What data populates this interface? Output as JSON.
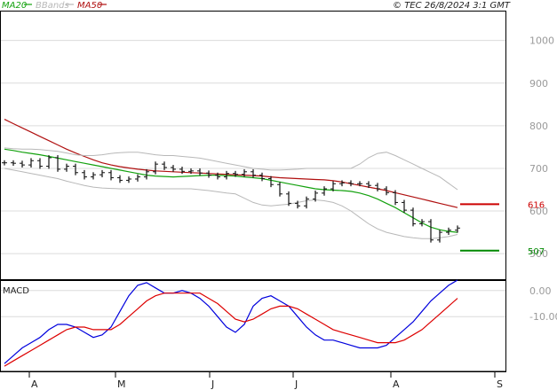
{
  "legend": [
    {
      "label": "MA20",
      "color": "#13a10e"
    },
    {
      "label": "BBands",
      "color": "#b8b8b8"
    },
    {
      "label": "MA50",
      "color": "#b01010"
    }
  ],
  "copyright": "© TEC 26/8/2024 3:1 GMT",
  "macd_title": "MACD",
  "chart_data": [
    {
      "type": "line",
      "panel": "price",
      "title": "",
      "y_ticks": [
        500,
        600,
        700,
        800,
        900,
        1000
      ],
      "ylim": [
        440,
        1070
      ],
      "x_month_labels": [
        "A",
        "M",
        "J",
        "J",
        "A",
        "S"
      ],
      "markers": [
        {
          "label": "616",
          "value": 616,
          "color": "#cc0000"
        },
        {
          "label": "507",
          "value": 507,
          "color": "#008800"
        }
      ],
      "series": [
        {
          "name": "MA20",
          "color": "#13a10e",
          "values": [
            745,
            742,
            738,
            735,
            732,
            728,
            724,
            720,
            716,
            712,
            708,
            704,
            700,
            696,
            692,
            688,
            684,
            682,
            681,
            680,
            681,
            682,
            683,
            684,
            684,
            683,
            682,
            680,
            678,
            676,
            672,
            668,
            664,
            660,
            656,
            652,
            650,
            649,
            648,
            646,
            642,
            636,
            628,
            618,
            608,
            596,
            584,
            572,
            562,
            556,
            552,
            550
          ]
        },
        {
          "name": "MA50",
          "color": "#b01010",
          "values": [
            815,
            805,
            795,
            785,
            775,
            765,
            755,
            745,
            736,
            728,
            720,
            713,
            708,
            704,
            701,
            698,
            696,
            694,
            693,
            692,
            691,
            690,
            689,
            688,
            687,
            686,
            685,
            684,
            683,
            682,
            680,
            678,
            677,
            676,
            675,
            674,
            673,
            671,
            668,
            664,
            660,
            656,
            652,
            648,
            643,
            638,
            633,
            628,
            623,
            618,
            613,
            608
          ]
        },
        {
          "name": "BBand upper",
          "color": "#b8b8b8",
          "values": [
            748,
            746,
            745,
            745,
            744,
            742,
            740,
            736,
            732,
            730,
            730,
            732,
            735,
            737,
            738,
            738,
            735,
            732,
            730,
            730,
            728,
            726,
            724,
            720,
            716,
            712,
            708,
            704,
            700,
            698,
            696,
            696,
            697,
            698,
            700,
            700,
            700,
            700,
            700,
            700,
            710,
            725,
            735,
            738,
            730,
            720,
            710,
            700,
            690,
            680,
            665,
            650
          ]
        },
        {
          "name": "BBand lower",
          "color": "#b8b8b8",
          "values": [
            700,
            696,
            692,
            688,
            684,
            680,
            676,
            670,
            665,
            660,
            656,
            654,
            653,
            652,
            652,
            652,
            652,
            652,
            652,
            652,
            652,
            652,
            650,
            648,
            645,
            642,
            640,
            630,
            620,
            614,
            612,
            614,
            616,
            620,
            624,
            626,
            624,
            620,
            612,
            600,
            585,
            570,
            558,
            550,
            545,
            540,
            537,
            535,
            535,
            537,
            540,
            545
          ]
        },
        {
          "name": "Price",
          "color": "#111111",
          "values": [
            713,
            712,
            708,
            718,
            705,
            725,
            698,
            705,
            690,
            680,
            685,
            690,
            678,
            672,
            675,
            680,
            692,
            710,
            702,
            698,
            693,
            694,
            689,
            684,
            680,
            688,
            686,
            692,
            684,
            676,
            662,
            640,
            618,
            612,
            628,
            642,
            652,
            664,
            666,
            664,
            664,
            660,
            652,
            643,
            620,
            602,
            570,
            575,
            532,
            550,
            555,
            560
          ]
        }
      ]
    },
    {
      "type": "line",
      "panel": "macd",
      "title": "MACD",
      "y_ticks": [
        0,
        -10
      ],
      "ylim": [
        -31,
        4
      ],
      "series": [
        {
          "name": "MACD",
          "color": "#0000dd",
          "values": [
            -28,
            -25,
            -22,
            -20,
            -18,
            -15,
            -13,
            -13,
            -14,
            -16,
            -18,
            -17,
            -14,
            -8,
            -2,
            2,
            3,
            1,
            -1,
            -1,
            0,
            -1,
            -3,
            -6,
            -10,
            -14,
            -16,
            -13,
            -6,
            -3,
            -2,
            -4,
            -6,
            -10,
            -14,
            -17,
            -19,
            -19,
            -20,
            -21,
            -22,
            -22,
            -22,
            -21,
            -18,
            -15,
            -12,
            -8,
            -4,
            -1,
            2,
            4
          ]
        },
        {
          "name": "Signal",
          "color": "#dd0000",
          "values": [
            -29,
            -27,
            -25,
            -23,
            -21,
            -19,
            -17,
            -15,
            -14,
            -14,
            -15,
            -15,
            -15,
            -13,
            -10,
            -7,
            -4,
            -2,
            -1,
            -1,
            -1,
            -1,
            -1,
            -3,
            -5,
            -8,
            -11,
            -12,
            -11,
            -9,
            -7,
            -6,
            -6,
            -7,
            -9,
            -11,
            -13,
            -15,
            -16,
            -17,
            -18,
            -19,
            -20,
            -20,
            -20,
            -19,
            -17,
            -15,
            -12,
            -9,
            -6,
            -3
          ]
        }
      ]
    }
  ]
}
